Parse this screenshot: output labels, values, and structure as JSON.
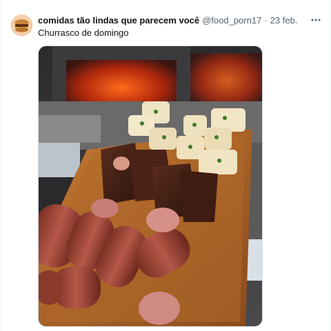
{
  "tweet": {
    "display_name": "comidas tão lindas que parecem você",
    "handle": "@food_porn17",
    "separator": "·",
    "date": "23 feb.",
    "text": "Churrasco de domingo"
  },
  "icons": {
    "more": "more-horizontal-icon",
    "avatar": "avatar-image"
  },
  "colors": {
    "primary_text": "#0f1419",
    "secondary_text": "#536471",
    "border": "#cfd9de"
  }
}
